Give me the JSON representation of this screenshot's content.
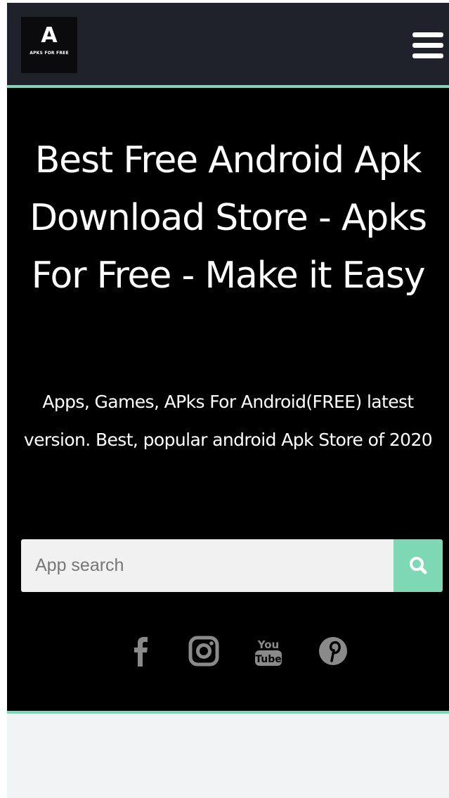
{
  "header": {
    "logo_letter": "A",
    "logo_text": "APKS FOR FREE",
    "menu_icon": "hamburger-menu-icon"
  },
  "hero": {
    "title": "Best Free Android Apk Download Store - Apks For Free - Make it Easy",
    "subtitle": "Apps, Games, APks For Android(FREE) latest version. Best, popular android Apk Store of 2020"
  },
  "search": {
    "placeholder": "App search",
    "value": "",
    "button_icon": "search-icon"
  },
  "social": [
    {
      "icon": "facebook-icon"
    },
    {
      "icon": "instagram-icon"
    },
    {
      "icon": "youtube-icon"
    },
    {
      "icon": "pinterest-icon"
    }
  ],
  "colors": {
    "header_bg": "#1f222a",
    "hero_bg": "#000000",
    "accent": "#7fd8b4",
    "social_icon": "#8a8a8a",
    "page_bg": "#f2f3f5"
  }
}
